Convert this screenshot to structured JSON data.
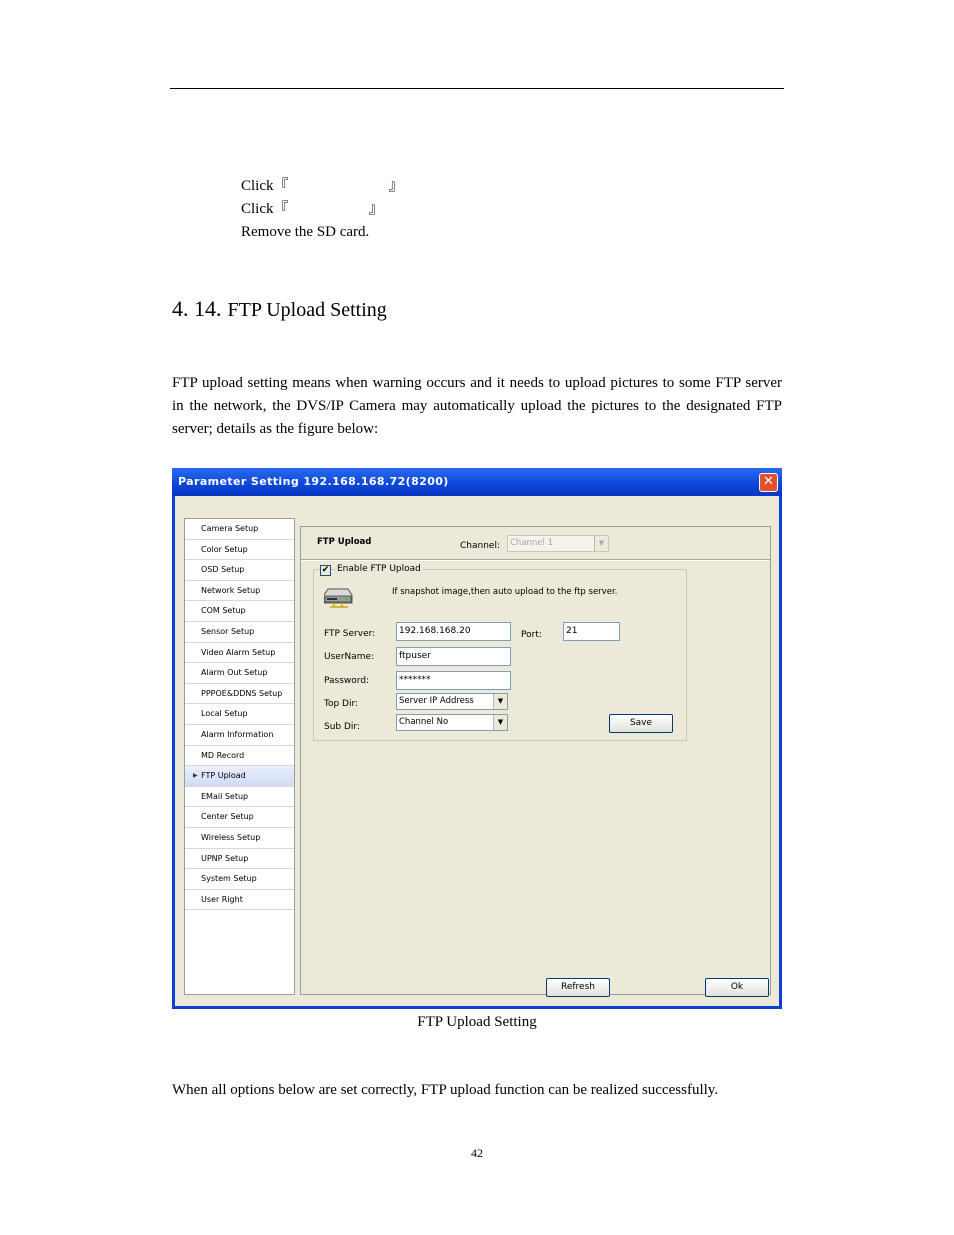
{
  "steps": [
    {
      "prefix": "Click『",
      "suffix": "』"
    },
    {
      "prefix": "Click『",
      "suffix": "』"
    },
    {
      "text": "Remove the SD card."
    }
  ],
  "section": {
    "number": "4. 14.",
    "title": "FTP Upload Setting"
  },
  "intro": "FTP upload setting means when warning occurs and it needs to upload pictures to some FTP server in the network, the DVS/IP Camera may automatically upload the pictures to the designated FTP server; details as the figure below:",
  "window": {
    "title": "Parameter Setting 192.168.168.72(8200)",
    "close_icon": "close-icon",
    "sidebar": [
      "Camera Setup",
      "Color Setup",
      "OSD Setup",
      "Network Setup",
      "COM Setup",
      "Sensor Setup",
      "Video Alarm Setup",
      "Alarm Out Setup",
      "PPPOE&DDNS Setup",
      "Local Setup",
      "Alarm Information",
      "MD Record",
      "FTP Upload",
      "EMail Setup",
      "Center Setup",
      "Wireless Setup",
      "UPNP Setup",
      "System Setup",
      "User Right"
    ],
    "selected_item": "FTP Upload",
    "panel_title": "FTP Upload",
    "channel_label": "Channel:",
    "channel_value": "Channel 1",
    "enable_label": "Enable FTP Upload",
    "enable_checked": "✔",
    "info_text": "If snapshot image,then auto upload to the ftp server.",
    "ftp_server_label": "FTP Server:",
    "ftp_server_value": "192.168.168.20",
    "port_label": "Port:",
    "port_value": "21",
    "username_label": "UserName:",
    "username_value": "ftpuser",
    "password_label": "Password:",
    "password_value": "*******",
    "top_dir_label": "Top Dir:",
    "top_dir_value": "Server IP Address",
    "sub_dir_label": "Sub Dir:",
    "sub_dir_value": "Channel No",
    "save_label": "Save",
    "refresh_label": "Refresh",
    "ok_label": "Ok",
    "colors": {
      "title_bar": "#0b46d8",
      "client_bg": "#ece9d8",
      "close": "#e1512f"
    }
  },
  "caption": "FTP Upload Setting",
  "closing": "When all options below are set correctly, FTP upload function can be realized successfully.",
  "page_number": "42"
}
